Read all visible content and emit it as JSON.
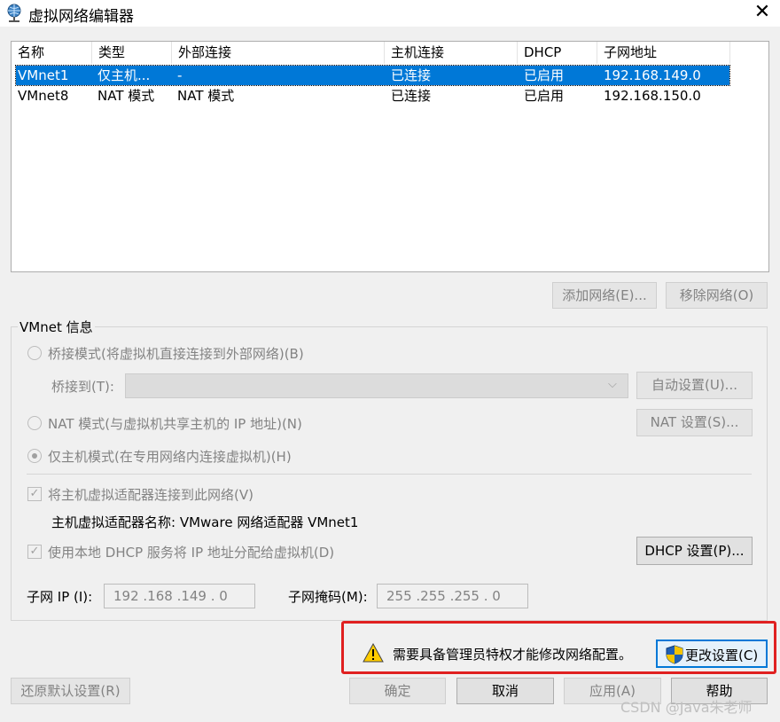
{
  "window": {
    "title": "虚拟网络编辑器",
    "close_label": "✕"
  },
  "network_list": {
    "columns": [
      "名称",
      "类型",
      "外部连接",
      "主机连接",
      "DHCP",
      "子网地址"
    ],
    "rows": [
      {
        "name": "VMnet1",
        "type": "仅主机...",
        "external": "-",
        "host": "已连接",
        "dhcp": "已启用",
        "subnet": "192.168.149.0",
        "selected": true
      },
      {
        "name": "VMnet8",
        "type": "NAT 模式",
        "external": "NAT 模式",
        "host": "已连接",
        "dhcp": "已启用",
        "subnet": "192.168.150.0",
        "selected": false
      }
    ]
  },
  "list_buttons": {
    "add": "添加网络(E)...",
    "remove": "移除网络(O)"
  },
  "vmnet_info": {
    "legend": "VMnet 信息",
    "bridged_label": "桥接模式(将虚拟机直接连接到外部网络)(B)",
    "bridge_to_label": "桥接到(T):",
    "bridge_to_value": "",
    "auto_settings": "自动设置(U)...",
    "nat_label": "NAT 模式(与虚拟机共享主机的 IP 地址)(N)",
    "nat_settings": "NAT 设置(S)...",
    "host_only_label": "仅主机模式(在专用网络内连接虚拟机)(H)",
    "connect_adapter_label": "将主机虚拟适配器连接到此网络(V)",
    "adapter_name_label": "主机虚拟适配器名称: VMware 网络适配器 VMnet1",
    "dhcp_label": "使用本地 DHCP 服务将 IP 地址分配给虚拟机(D)",
    "dhcp_settings": "DHCP 设置(P)...",
    "subnet_ip_label": "子网 IP (I):",
    "subnet_ip_value": "192 .168 .149 .  0",
    "subnet_mask_label": "子网掩码(M):",
    "subnet_mask_value": "255 .255 .255 .  0"
  },
  "admin_notice": {
    "text": "需要具备管理员特权才能修改网络配置。",
    "change_button": "更改设置(C)"
  },
  "footer": {
    "restore": "还原默认设置(R)",
    "ok": "确定",
    "cancel": "取消",
    "apply": "应用(A)",
    "help": "帮助"
  },
  "watermark": "CSDN @Java朱老师",
  "colors": {
    "selection": "#0078d7",
    "highlight_box": "#e02020",
    "warning": "#ffcc00"
  }
}
